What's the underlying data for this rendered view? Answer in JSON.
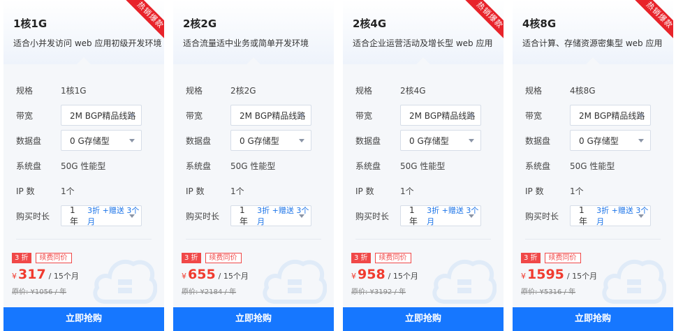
{
  "labels": {
    "spec": "规格",
    "bandwidth": "带宽",
    "data_disk": "数据盘",
    "system_disk": "系统盘",
    "ip_count": "IP 数",
    "duration": "购买时长",
    "renew_same": "续费同价",
    "buy_button": "立即抢购",
    "per_period": "/ 15个月",
    "currency": "¥"
  },
  "cards": [
    {
      "title": "1核1G",
      "desc": "适合小并发访问 web 应用初级开发环境",
      "hot": true,
      "hot_label": "热销爆款",
      "spec": "1核1G",
      "bandwidth": "2M BGP精品线路",
      "data_disk": "0 G存储型",
      "system_disk": "50G 性能型",
      "ip_count": "1个",
      "duration_year": "1 年",
      "duration_promo": "3折 +赠送 3个月",
      "discount_tag": "3 折",
      "price": "317",
      "original_price": "原价: ¥1056 / 年"
    },
    {
      "title": "2核2G",
      "desc": "适合流量适中业务或简单开发环境",
      "hot": false,
      "hot_label": "",
      "spec": "2核2G",
      "bandwidth": "2M BGP精品线路",
      "data_disk": "0 G存储型",
      "system_disk": "50G 性能型",
      "ip_count": "1个",
      "duration_year": "1 年",
      "duration_promo": "3折 +赠送 3个月",
      "discount_tag": "3 折",
      "price": "655",
      "original_price": "原价: ¥2184 / 年"
    },
    {
      "title": "2核4G",
      "desc": "适合企业运营活动及增长型 web 应用",
      "hot": true,
      "hot_label": "热销爆款",
      "spec": "2核4G",
      "bandwidth": "2M BGP精品线路",
      "data_disk": "0 G存储型",
      "system_disk": "50G 性能型",
      "ip_count": "1个",
      "duration_year": "1 年",
      "duration_promo": "3折 +赠送 3个月",
      "discount_tag": "3 折",
      "price": "958",
      "original_price": "原价: ¥3192 / 年"
    },
    {
      "title": "4核8G",
      "desc": "适合计算、存储资源密集型 web 应用",
      "hot": true,
      "hot_label": "热销爆款",
      "spec": "4核8G",
      "bandwidth": "2M BGP精品线路",
      "data_disk": "0 G存储型",
      "system_disk": "50G 性能型",
      "ip_count": "1个",
      "duration_year": "1 年",
      "duration_promo": "3折 +赠送 3个月",
      "discount_tag": "3 折",
      "price": "1595",
      "original_price": "原价: ¥5316 / 年"
    }
  ],
  "colors": {
    "accent": "#1677ff",
    "price": "#f03b2f",
    "hot_ribbon": "#e8232a"
  }
}
